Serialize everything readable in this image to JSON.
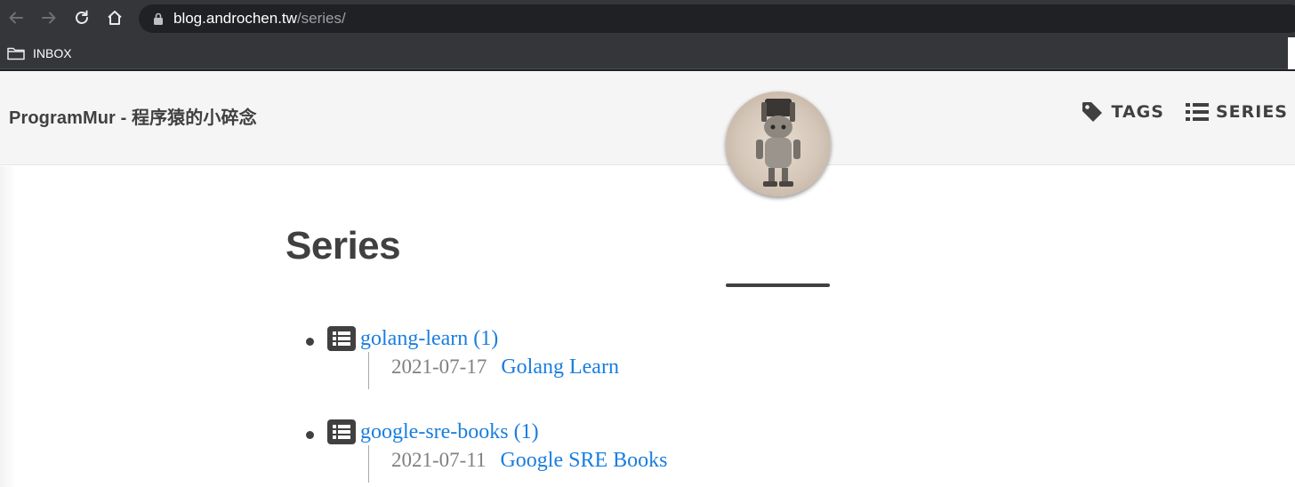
{
  "browser": {
    "url_host": "blog.androchen.tw",
    "url_path": "/series/",
    "bookmark_label": "INBOX"
  },
  "site": {
    "brand": "ProgramMur - 程序猿的小碎念",
    "nav": [
      {
        "label": "TAGS",
        "icon": "tag-icon"
      },
      {
        "label": "SERIES",
        "icon": "list-icon"
      }
    ]
  },
  "page": {
    "title": "Series",
    "series": [
      {
        "label": "golang-learn (1)",
        "icon": "list-icon",
        "posts": [
          {
            "date": "2021-07-17",
            "title": "Golang Learn"
          }
        ]
      },
      {
        "label": "google-sre-books (1)",
        "icon": "list-icon",
        "posts": [
          {
            "date": "2021-07-11",
            "title": "Google SRE Books"
          }
        ]
      }
    ]
  },
  "colors": {
    "chrome_bg": "#35363a",
    "omnibox_bg": "#202124",
    "nav_bg": "#f5f5f5",
    "text_dark": "#404040",
    "link": "#1a7ee0",
    "date": "#808080"
  }
}
